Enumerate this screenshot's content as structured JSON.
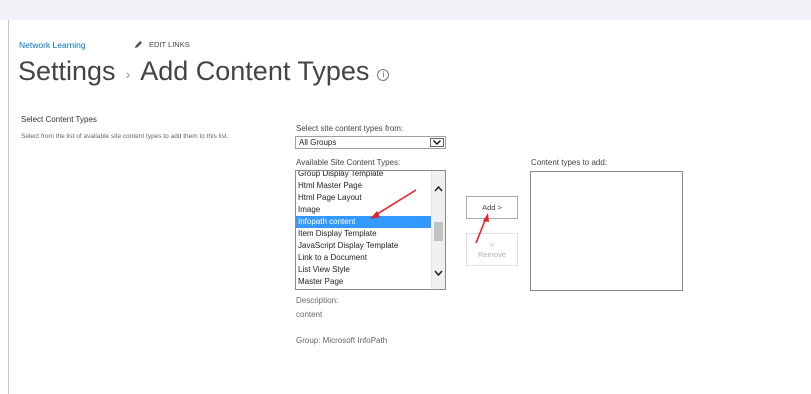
{
  "breadcrumb": {
    "site_link": "Network Learning",
    "edit_links": "EDIT LINKS"
  },
  "title": {
    "root": "Settings",
    "separator": "›",
    "current": "Add Content Types",
    "info": "i"
  },
  "section": {
    "title": "Select Content Types",
    "description": "Select from the list of available site content types to add them to this list."
  },
  "source": {
    "label": "Select site content types from:",
    "selected": "All Groups"
  },
  "available": {
    "label": "Available Site Content Types:",
    "items": [
      "Group Display Template",
      "Html Master Page",
      "Html Page Layout",
      "Image",
      "Infopath content",
      "Item Display Template",
      "JavaScript Display Template",
      "Link to a Document",
      "List View Style",
      "Master Page"
    ],
    "selected_index": 4
  },
  "buttons": {
    "add": "Add >",
    "remove_arrow": "<",
    "remove": "Remove"
  },
  "to_add": {
    "label": "Content types to add:"
  },
  "details": {
    "description_label": "Description:",
    "description_value": "content",
    "group_line": "Group: Microsoft InfoPath"
  },
  "colors": {
    "accent": "#0072c6",
    "selection": "#3399ff",
    "annotation": "#e8202a"
  }
}
